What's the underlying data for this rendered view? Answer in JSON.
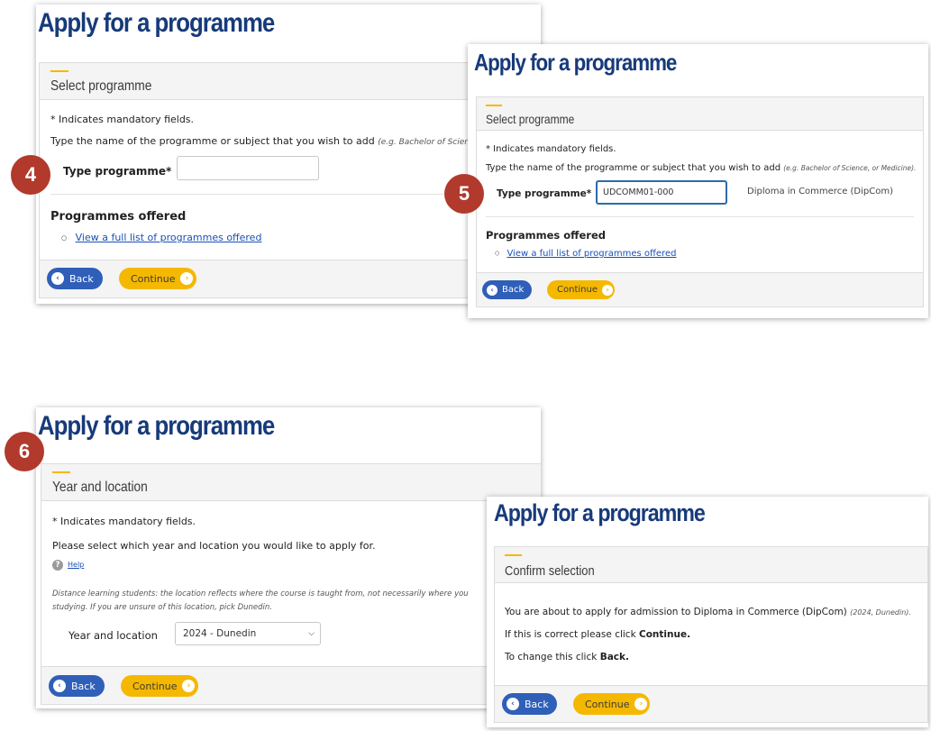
{
  "panels": {
    "p4": {
      "title": "Apply for a programme",
      "section": "Select programme",
      "mandatory": "* Indicates mandatory fields.",
      "instruction": "Type the name of the programme or subject that you wish to add",
      "example": "(e.g. Bachelor of Science, o",
      "field_label": "Type programme*",
      "field_value": "",
      "offered_heading": "Programmes offered",
      "offered_link": "View a full list of programmes offered",
      "back_label": "Back",
      "continue_label": "Continue"
    },
    "p5": {
      "title": "Apply for a programme",
      "section": "Select programme",
      "mandatory": "* Indicates mandatory fields.",
      "instruction": "Type the name of the programme or subject that you wish to add",
      "example": "(e.g. Bachelor of Science, or Medicine).",
      "field_label": "Type programme*",
      "field_value": "UDCOMM01-000",
      "match_text": "Diploma in Commerce (DipCom)",
      "offered_heading": "Programmes offered",
      "offered_link": "View a full list of programmes offered",
      "back_label": "Back",
      "continue_label": "Continue"
    },
    "p6": {
      "title": "Apply for a programme",
      "section": "Year and location",
      "mandatory": "* Indicates mandatory fields.",
      "instruction": "Please select which year and location you would like to apply for.",
      "help_label": "Help",
      "note_line1": "Distance learning students: the location reflects where the course is taught from, not necessarily where you",
      "note_line2": "studying. If you are unsure of this location, pick Dunedin.",
      "select_label": "Year and location",
      "select_value": "2024 - Dunedin",
      "back_label": "Back",
      "continue_label": "Continue"
    },
    "p7": {
      "title": "Apply for a programme",
      "section": "Confirm selection",
      "confirm_prefix": "You are about to apply for admission to Diploma in Commerce (DipCom)",
      "confirm_detail": "(2024, Dunedin).",
      "line2_prefix": "If this is correct please click",
      "line2_bold": "Continue.",
      "line3_prefix": "To change this click",
      "line3_bold": "Back.",
      "back_label": "Back",
      "continue_label": "Continue"
    }
  },
  "steps": [
    "4",
    "5",
    "6"
  ],
  "icons": {
    "back": "back-arrow-icon",
    "continue": "continue-arrow-icon",
    "help": "help-icon",
    "select": "chevron-down-icon"
  },
  "colors": {
    "title": "#173a7a",
    "accent": "#f5b800",
    "back_button": "#2f5fb8",
    "continue_button": "#f5b800",
    "step_badge": "#b13a2c",
    "link": "#1a4fb5"
  }
}
